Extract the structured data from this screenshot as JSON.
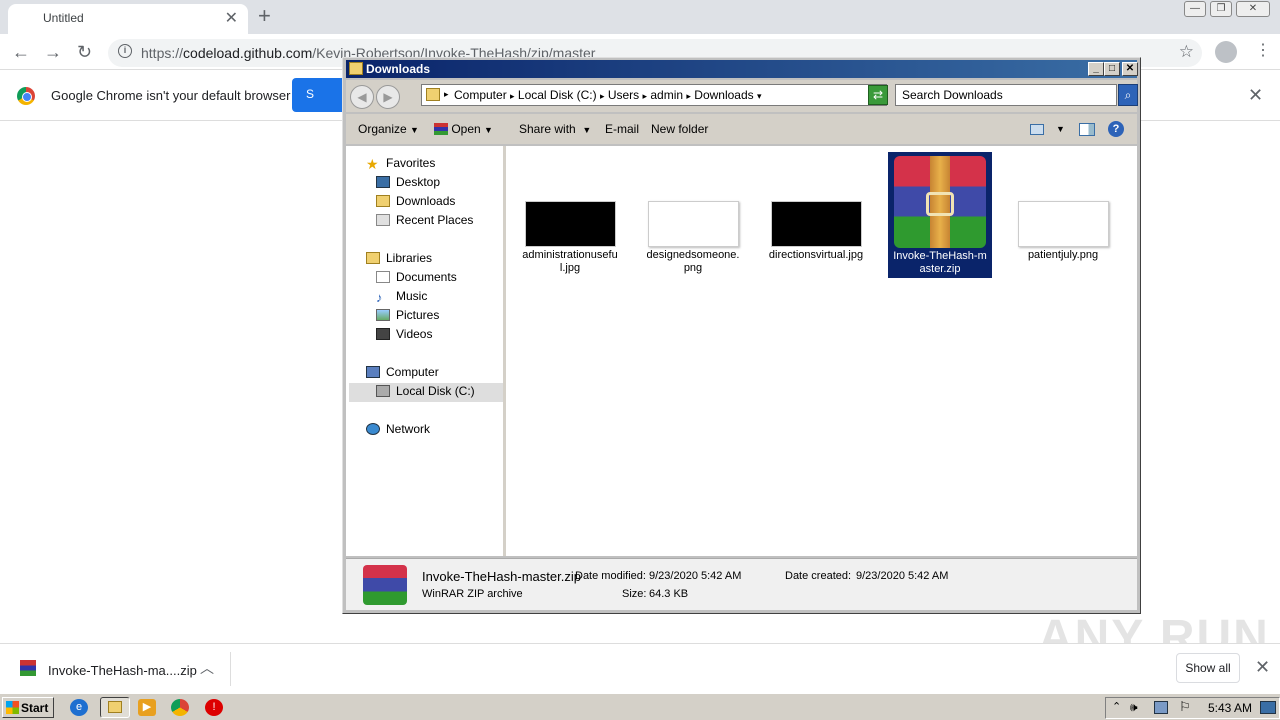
{
  "browser": {
    "tab_title": "Untitled",
    "url_prefix": "https://",
    "url_host": "codeload.github.com",
    "url_path": "/Kevin-Robertson/Invoke-TheHash/zip/master",
    "infobar_text": "Google Chrome isn't your default browser",
    "infobar_button": "S"
  },
  "downloads_bar": {
    "file_name": "Invoke-TheHash-ma....zip",
    "show_all": "Show all"
  },
  "watermark": "ANY RUN",
  "explorer": {
    "title": "Downloads",
    "breadcrumbs": [
      "Computer",
      "Local Disk (C:)",
      "Users",
      "admin",
      "Downloads"
    ],
    "search_placeholder": "Search Downloads",
    "commands": {
      "organize": "Organize",
      "open": "Open",
      "share_with": "Share with",
      "email": "E-mail",
      "new_folder": "New folder"
    },
    "nav": {
      "favorites": "Favorites",
      "desktop": "Desktop",
      "downloads": "Downloads",
      "recent_places": "Recent Places",
      "libraries": "Libraries",
      "documents": "Documents",
      "music": "Music",
      "pictures": "Pictures",
      "videos": "Videos",
      "computer": "Computer",
      "local_disk": "Local Disk (C:)",
      "network": "Network"
    },
    "files": [
      {
        "name": "administrationuseful.jpg",
        "name_l1": "administrationusefu",
        "name_l2": "l.jpg",
        "thumb": "black"
      },
      {
        "name": "designedsomeone.png",
        "name_l1": "designedsomeone.",
        "name_l2": "png",
        "thumb": "white"
      },
      {
        "name": "directionsvirtual.jpg",
        "name_l1": "directionsvirtual.jpg",
        "name_l2": "",
        "thumb": "black"
      },
      {
        "name": "Invoke-TheHash-master.zip",
        "name_l1": "Invoke-TheHash-m",
        "name_l2": "aster.zip",
        "thumb": "winrar",
        "selected": true
      },
      {
        "name": "patientjuly.png",
        "name_l1": "patientjuly.png",
        "name_l2": "",
        "thumb": "white"
      }
    ],
    "details": {
      "name": "Invoke-TheHash-master.zip",
      "type": "WinRAR ZIP archive",
      "modified_label": "Date modified:",
      "modified_value": "9/23/2020 5:42 AM",
      "created_label": "Date created:",
      "created_value": "9/23/2020 5:42 AM",
      "size_label": "Size:",
      "size_value": "64.3 KB"
    }
  },
  "taskbar": {
    "start": "Start",
    "clock": "5:43 AM"
  },
  "colors": {
    "selection": "#0a246a",
    "chrome_blue": "#1a73e8",
    "title_gradient_start": "#0a246a",
    "title_gradient_end": "#3a6ea5"
  }
}
